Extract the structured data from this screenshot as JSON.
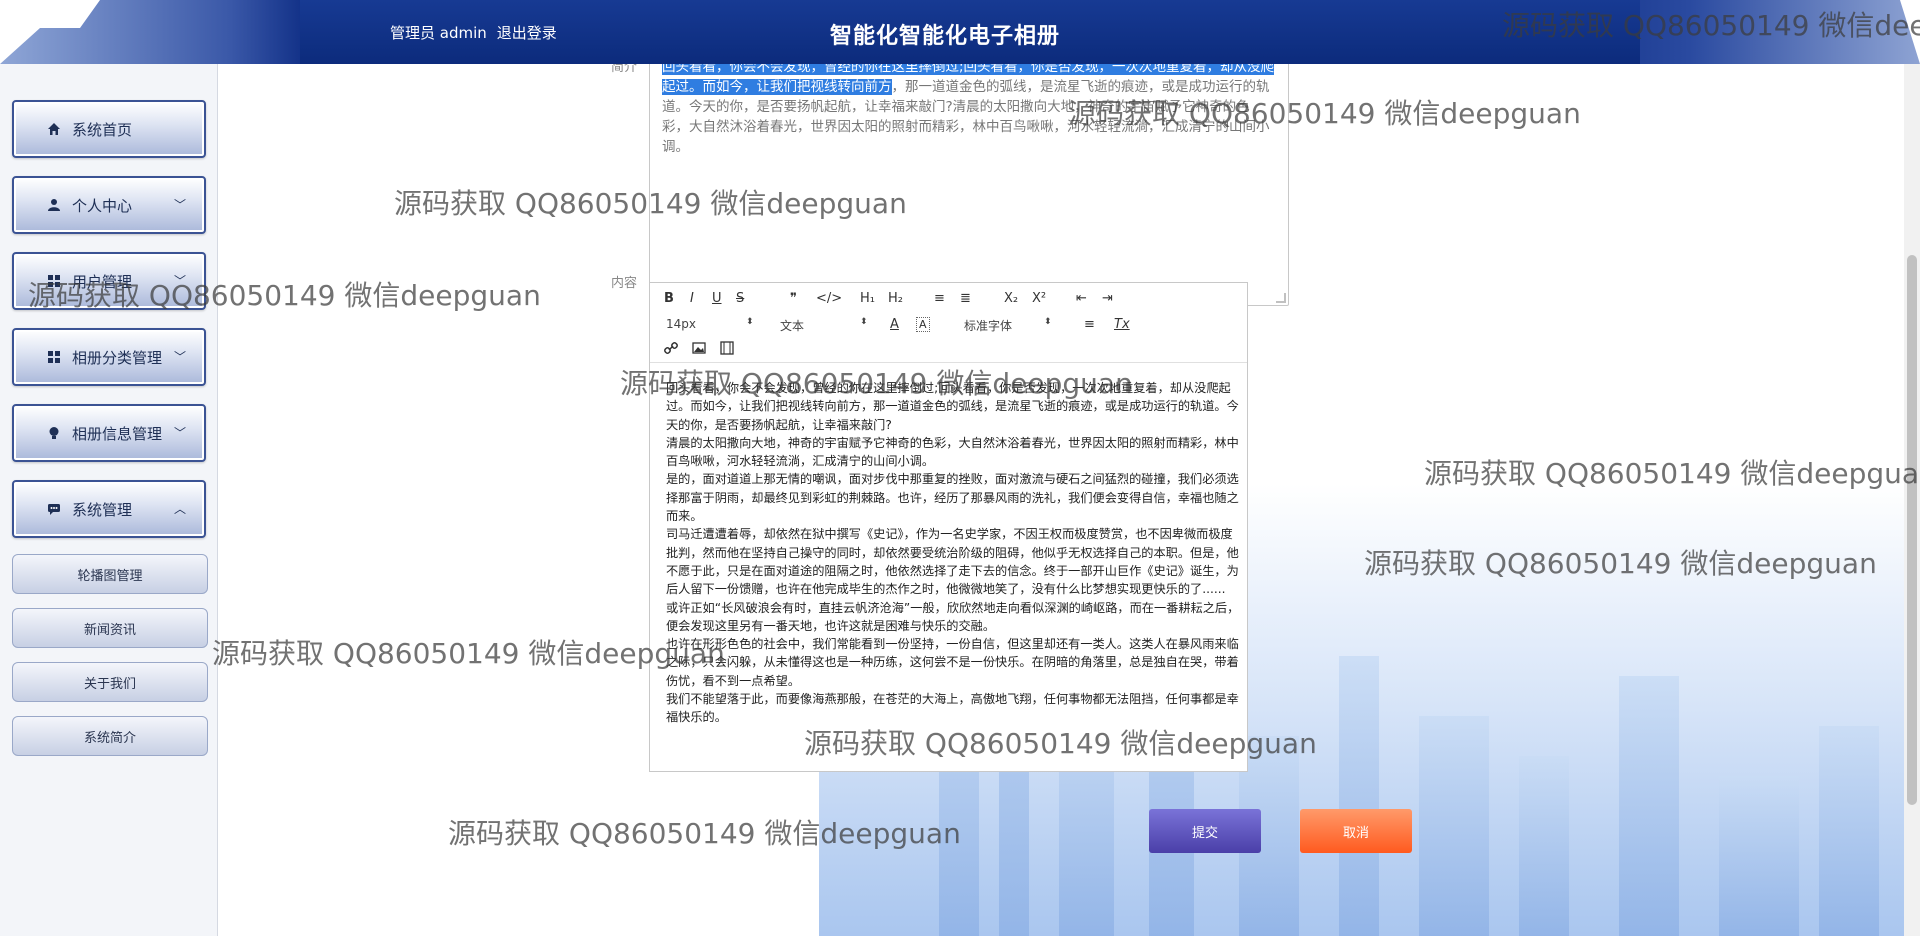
{
  "header": {
    "admin_label": "管理员 admin",
    "logout_label": "退出登录",
    "app_title": "智能化智能化电子相册"
  },
  "sidebar": {
    "items": [
      {
        "label": "系统首页",
        "icon": "home-icon"
      },
      {
        "label": "个人中心",
        "icon": "user-icon",
        "arrow": "chevron-down"
      },
      {
        "label": "用户管理",
        "icon": "grid-icon",
        "arrow": "chevron-down"
      },
      {
        "label": "相册分类管理",
        "icon": "grid-icon",
        "arrow": "chevron-down"
      },
      {
        "label": "相册信息管理",
        "icon": "bulb-icon",
        "arrow": "chevron-down"
      },
      {
        "label": "系统管理",
        "icon": "chat-icon",
        "arrow": "chevron-up"
      }
    ],
    "sub_items": [
      "轮播图管理",
      "新闻资讯",
      "关于我们",
      "系统简介"
    ]
  },
  "form": {
    "intro_label": "简介",
    "content_label": "内容",
    "intro_selected": "回头看看，你会不会发现，曾经的你在这里摔倒过;回头看看，你是否发现，一次次地重复着，却从没爬起过。而如今，让我们把视线转向前方",
    "intro_rest": "，那一道道金色的弧线，是流星飞逝的痕迹，或是成功运行的轨道。今天的你，是否要扬帆起航，让幸福来敲门?清晨的太阳撒向大地，神奇的宇宙赋予它神奇的色彩，大自然沐浴着春光，世界因太阳的照射而精彩，林中百鸟啾啾，河水轻轻流淌，汇成清宁的山间小调。",
    "editor_toolbar": {
      "font_size": "14px",
      "block_format": "文本",
      "font_family": "标准字体",
      "bold": "B",
      "italic": "I",
      "underline": "U",
      "strike": "S",
      "quote": "❞",
      "code": "</>",
      "h1": "H₁",
      "h2": "H₂",
      "ordered_list": "≡",
      "bullet_list": "≣",
      "subscript": "X₂",
      "superscript": "X²",
      "outdent": "⇤",
      "indent": "⇥",
      "color": "A",
      "background": "A",
      "align": "≡",
      "clean": "Tx"
    },
    "editor_paragraphs": [
      "回头看看，你会不会发现，曾经的你在这里摔倒过;回头看看，你是否发现，一次次地重复着，却从没爬起过。而如今，让我们把视线转向前方，那一道道金色的弧线，是流星飞逝的痕迹，或是成功运行的轨道。今天的你，是否要扬帆起航，让幸福来敲门?",
      "清晨的太阳撒向大地，神奇的宇宙赋予它神奇的色彩，大自然沐浴着春光，世界因太阳的照射而精彩，林中百鸟啾啾，河水轻轻流淌，汇成清宁的山间小调。",
      "是的，面对道道上那无情的嘲讽，面对步伐中那重复的挫败，面对激流与硬石之间猛烈的碰撞，我们必须选择那富于阴雨，却最终见到彩虹的荆棘路。也许，经历了那暴风雨的洗礼，我们便会变得自信，幸福也随之而来。",
      "司马迁遭遭着辱，却依然在狱中撰写《史记》，作为一名史学家，不因王权而极度赞赏，也不因卑微而极度批判，然而他在坚持自己操守的同时，却依然要受统治阶级的阻碍，他似乎无权选择自己的本职。但是，他不愿于此，只是在面对道途的阻隔之时，他依然选择了走下去的信念。终于一部开山巨作《史记》诞生，为后人留下一份馈赠，也许在他完成毕生的杰作之时，他微微地笑了，没有什么比梦想实现更快乐的了......",
      "或许正如“长风破浪会有时，直挂云帆济沧海”一般，欣欣然地走向看似深渊的崎岖路，而在一番耕耘之后，便会发现这里另有一番天地，也许这就是困难与快乐的交融。",
      "也许在形形色色的社会中，我们常能看到一份坚持，一份自信，但这里却还有一类人。这类人在暴风雨来临之际，只会闪躲，从未懂得这也是一种历练，这何尝不是一份快乐。在阴暗的角落里，总是独自在哭，带着伤忧，看不到一点希望。",
      "我们不能望落于此，而要像海燕那般，在苍茫的大海上，高傲地飞翔，任何事物都无法阻挡，任何事都是幸福快乐的。"
    ],
    "submit_label": "提交",
    "cancel_label": "取消"
  },
  "watermark": "源码获取 QQ86050149 微信deepguan"
}
